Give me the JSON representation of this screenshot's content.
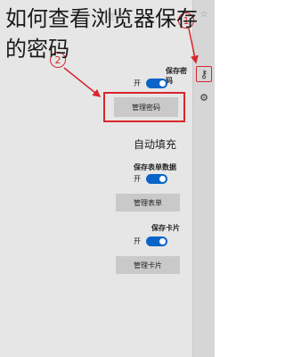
{
  "overlay": {
    "title_line1": "如何查看浏览器保存",
    "title_line2": "的密码"
  },
  "panel": {
    "faint_heading": "密码",
    "passwords_section": {
      "label": "保存密码",
      "toggle_text": "开",
      "manage_button": "管理密码"
    },
    "autofill_title": "自动填充",
    "form_section": {
      "label": "保存表单数据",
      "toggle_text": "开",
      "manage_button": "管理表单"
    },
    "card_section": {
      "label": "保存卡片",
      "toggle_text": "开",
      "manage_button": "管理卡片"
    }
  },
  "rail": {
    "icons": [
      "star-icon",
      "key-icon",
      "settings-icon"
    ]
  },
  "annotations": {
    "badge1": "1",
    "badge2": "2",
    "highlight_color": "#d8262c"
  },
  "colors": {
    "panel_bg": "#e6e6e6",
    "toggle_on": "#0a64c8",
    "button_bg": "#c9c9c9"
  }
}
